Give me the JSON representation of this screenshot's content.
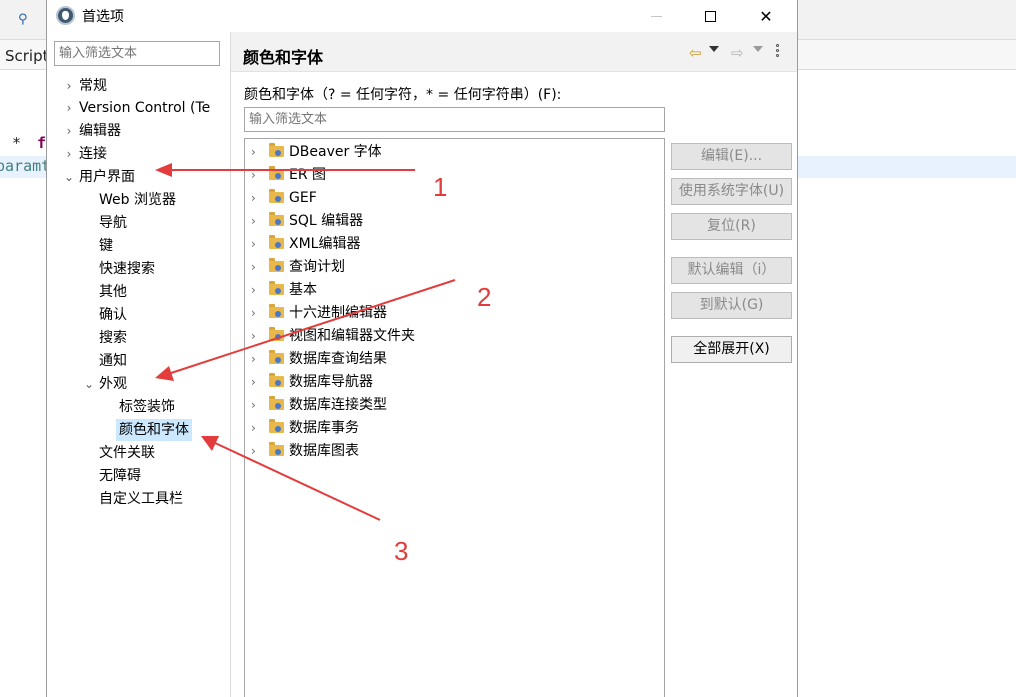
{
  "background": {
    "tab_text": "Script",
    "code_line1_star": "*",
    "code_line1_kw": "f",
    "code_line2": "paramt"
  },
  "dialog": {
    "title": "首选项",
    "close_glyph": "✕"
  },
  "nav": {
    "filter_placeholder": "输入筛选文本",
    "items": [
      {
        "label": "常规",
        "arrow": "›"
      },
      {
        "label": "Version Control (Te",
        "arrow": "›"
      },
      {
        "label": "编辑器",
        "arrow": "›"
      },
      {
        "label": "连接",
        "arrow": "›"
      },
      {
        "label": "用户界面",
        "arrow": "⌄"
      },
      {
        "label": "Web 浏览器"
      },
      {
        "label": "导航"
      },
      {
        "label": "键"
      },
      {
        "label": "快速搜索"
      },
      {
        "label": "其他"
      },
      {
        "label": "确认"
      },
      {
        "label": "搜索"
      },
      {
        "label": "通知"
      },
      {
        "label": "外观",
        "arrow": "⌄"
      },
      {
        "label": "标签装饰"
      },
      {
        "label": "颜色和字体"
      },
      {
        "label": "文件关联"
      },
      {
        "label": "无障碍"
      },
      {
        "label": "自定义工具栏"
      }
    ]
  },
  "panel": {
    "title": "颜色和字体",
    "back_glyph": "⇦",
    "forward_glyph": "⇨",
    "filter_label": "颜色和字体（? = 任何字符，* = 任何字符串）(F):",
    "filter_placeholder": "输入筛选文本",
    "categories": [
      "DBeaver 字体",
      "ER 图",
      "GEF",
      "SQL 编辑器",
      "XML编辑器",
      "查询计划",
      "基本",
      "十六进制编辑器",
      "视图和编辑器文件夹",
      "数据库查询结果",
      "数据库导航器",
      "数据库连接类型",
      "数据库事务",
      "数据库图表"
    ],
    "list_arrow": "›",
    "buttons": {
      "edit": "编辑(E)...",
      "use_system_font": "使用系统字体(U)",
      "reset": "复位(R)",
      "edit_default": "默认编辑（i）",
      "goto_default": "到默认(G)",
      "expand_all": "全部展开(X)"
    }
  },
  "annotations": {
    "labels": [
      "1",
      "2",
      "3"
    ],
    "color": "#e33c3c"
  }
}
